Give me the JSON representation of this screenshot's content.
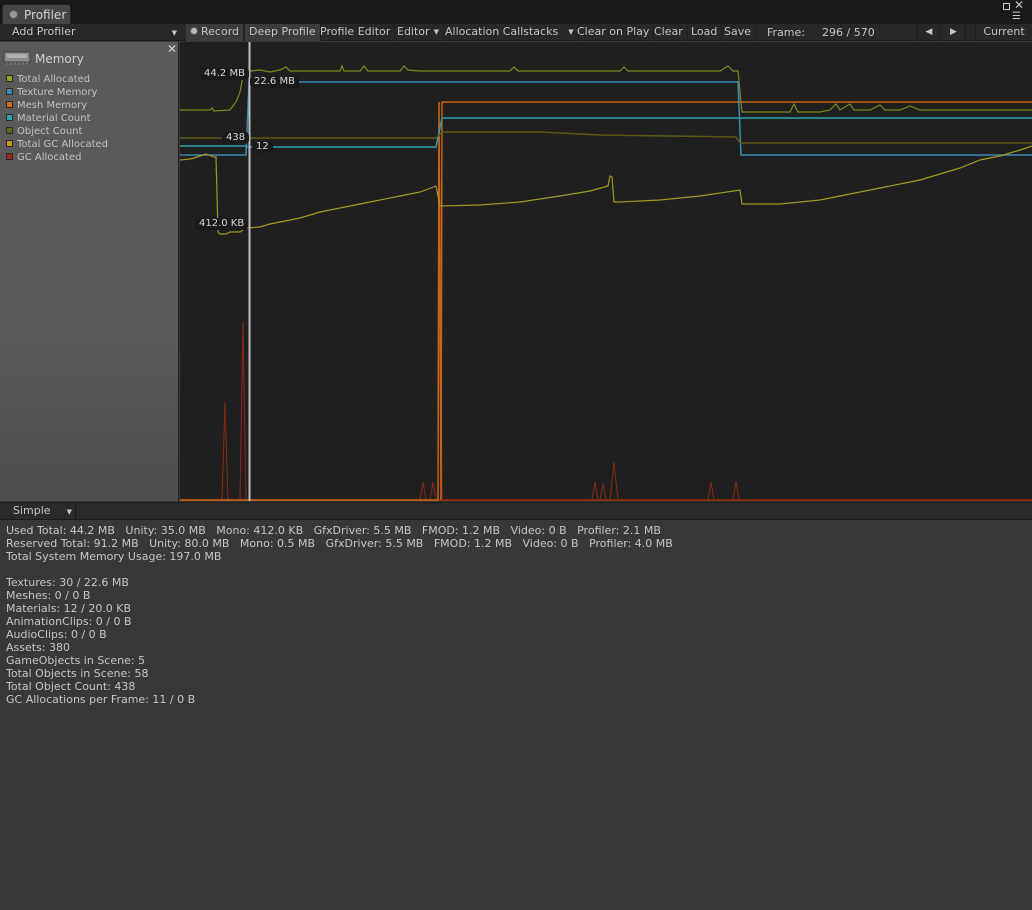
{
  "window": {
    "tab_title": "Profiler"
  },
  "toolbar": {
    "add_profiler": "Add Profiler",
    "record": "Record",
    "deep_profile": "Deep Profile",
    "profile_editor": "Profile Editor",
    "target": "Editor",
    "allocation_callstacks": "Allocation Callstacks",
    "clear_on_play": "Clear on Play",
    "clear": "Clear",
    "load": "Load",
    "save": "Save",
    "frame_label": "Frame:",
    "frame_value": "296 / 570",
    "current": "Current"
  },
  "legend": {
    "title": "Memory",
    "items": [
      {
        "label": "Total Allocated",
        "color": "#8ea020"
      },
      {
        "label": "Texture Memory",
        "color": "#3a8ab0"
      },
      {
        "label": "Mesh Memory",
        "color": "#d06818"
      },
      {
        "label": "Material Count",
        "color": "#30a0b0"
      },
      {
        "label": "Object Count",
        "color": "#6a6020"
      },
      {
        "label": "Total GC Allocated",
        "color": "#c89010"
      },
      {
        "label": "GC Allocated",
        "color": "#a02818"
      }
    ]
  },
  "graph": {
    "labels": {
      "total_allocated": "44.2 MB",
      "texture_memory": "22.6 MB",
      "object_count": "438",
      "material_count": "12",
      "gc_total": "412.0 KB"
    }
  },
  "view": {
    "mode": "Simple"
  },
  "details": {
    "used_total": "Used Total: 44.2 MB   Unity: 35.0 MB   Mono: 412.0 KB   GfxDriver: 5.5 MB   FMOD: 1.2 MB   Video: 0 B   Profiler: 2.1 MB",
    "reserved_total": "Reserved Total: 91.2 MB   Unity: 80.0 MB   Mono: 0.5 MB   GfxDriver: 5.5 MB   FMOD: 1.2 MB   Video: 0 B   Profiler: 4.0 MB",
    "system_usage": "Total System Memory Usage: 197.0 MB",
    "textures": "Textures: 30 / 22.6 MB",
    "meshes": "Meshes: 0 / 0 B",
    "materials": "Materials: 12 / 20.0 KB",
    "animation_clips": "AnimationClips: 0 / 0 B",
    "audio_clips": "AudioClips: 0 / 0 B",
    "assets": "Assets: 380",
    "gameobjects": "GameObjects in Scene: 5",
    "total_objects": "Total Objects in Scene: 58",
    "object_count": "Total Object Count: 438",
    "gc_allocations": "GC Allocations per Frame: 11 / 0 B"
  }
}
